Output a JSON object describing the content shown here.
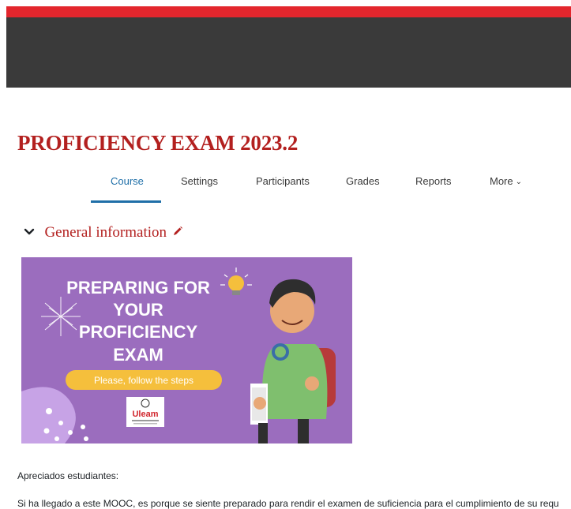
{
  "course": {
    "title": "PROFICIENCY EXAM 2023.2"
  },
  "nav": {
    "tabs": [
      {
        "label": "Course",
        "active": true
      },
      {
        "label": "Settings"
      },
      {
        "label": "Participants"
      },
      {
        "label": "Grades"
      },
      {
        "label": "Reports"
      },
      {
        "label": "More"
      }
    ]
  },
  "section": {
    "title": "General information",
    "icons": [
      "chevron-down-icon",
      "pencil-edit-icon"
    ]
  },
  "banner": {
    "headline": [
      "PREPARING FOR",
      "YOUR",
      "PROFICIENCY",
      "EXAM"
    ],
    "button_text": "Please, follow the steps",
    "logo_text": "Uleam"
  },
  "content": {
    "greeting": "Apreciados estudiantes:",
    "intro": "Si ha llegado a este MOOC, es porque se siente preparado para rendir el examen de suficiencia para el cumplimiento de su requ"
  },
  "colors": {
    "top_bar": "#e3262d",
    "header": "#3a3a3a",
    "title": "#b3201f",
    "active_tab": "#1f6fa8",
    "banner_bg": "#9b6dbe",
    "banner_button": "#f5bf3c"
  }
}
